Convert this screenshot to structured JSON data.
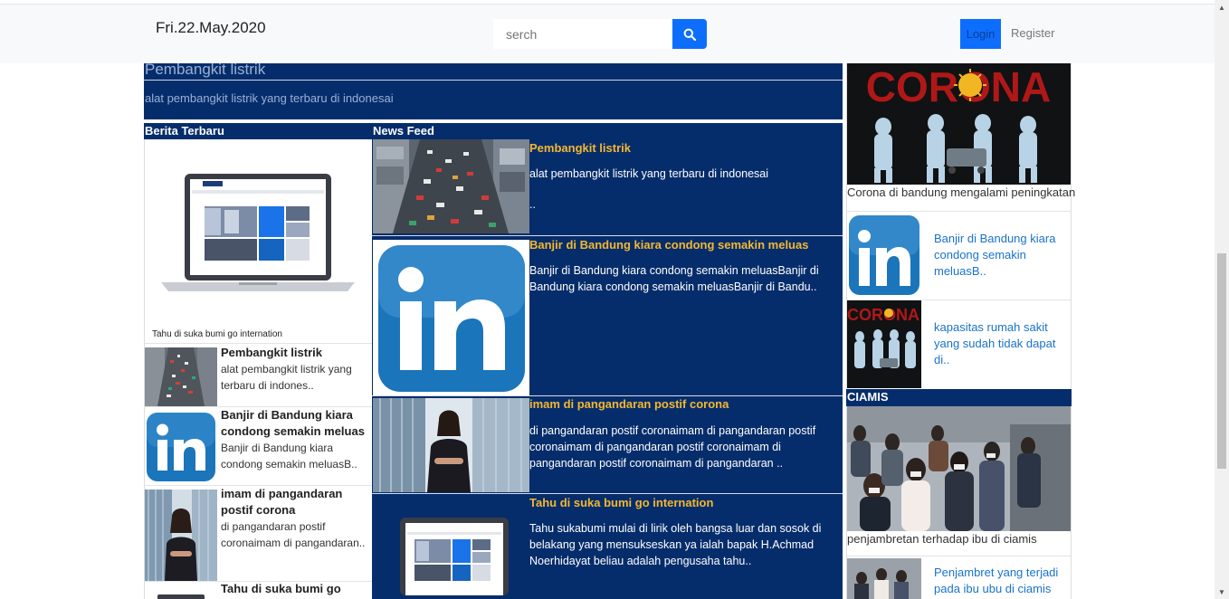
{
  "header": {
    "date": "Fri.22.May.2020",
    "search_placeholder": "serch",
    "login_label": "Login",
    "register_label": "Register"
  },
  "hero": {
    "title": "Pembangkit listrik",
    "description": "alat pembangkit listrik yang terbaru di indonesai"
  },
  "left": {
    "header": "Berita Terbaru",
    "featured_caption": "Tahu di suka bumi go internation",
    "items": [
      {
        "title": "Pembangkit listrik",
        "desc": "alat pembangkit listrik yang terbaru di indones.."
      },
      {
        "title": "Banjir di Bandung kiara condong semakin meluas",
        "desc": "Banjir di Bandung kiara condong semakin meluasB.."
      },
      {
        "title": "imam di pangandaran postif corona",
        "desc": "di pangandaran postif coronaimam di pangandaran.."
      },
      {
        "title": "Tahu di suka bumi go",
        "desc": ""
      }
    ]
  },
  "feed": {
    "header": "News Feed",
    "items": [
      {
        "title": "Pembangkit listrik",
        "desc": "alat pembangkit listrik yang terbaru di indonesai",
        "extra": ".."
      },
      {
        "title": "Banjir di Bandung kiara condong semakin meluas",
        "desc": "Banjir di Bandung kiara condong semakin meluasBanjir di Bandung kiara condong semakin meluasBanjir di Bandu.."
      },
      {
        "title": "imam di pangandaran postif corona",
        "desc": "di pangandaran postif coronaimam di pangandaran postif coronaimam di pangandaran postif coronaimam di pangandaran postif coronaimam di pangandaran .."
      },
      {
        "title": "Tahu di suka bumi go internation",
        "desc": "Tahu sukabumi mulai di lirik oleh bangsa luar dan sosok di belakang yang mensukseskan ya ialah bapak H.Achmad Noerhidayat beliau adalah pengusaha tahu.."
      }
    ]
  },
  "right": {
    "corona_banner_text": "CORONA",
    "corona_caption": "Corona di bandung mengalami peningkatan",
    "links": [
      "Banjir di Bandung kiara condong semakin meluasB..",
      "kapasitas rumah sakit yang sudah tidak dapat di.."
    ],
    "ciamis_header": "CIAMIS",
    "ciamis_caption": "penjambretan terhadap ibu di ciamis",
    "ciamis_link": "Penjambret yang terjadi pada ibu ubu di ciamis"
  },
  "colors": {
    "navy": "#062d6b",
    "accent_blue": "#0d6efd",
    "headline_gold": "#f4b731",
    "link_blue": "#1a73c9"
  }
}
